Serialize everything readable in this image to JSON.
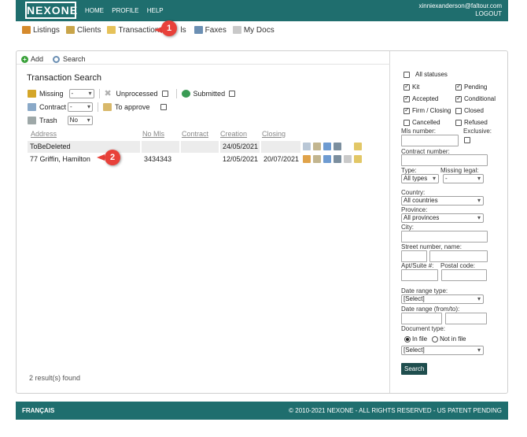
{
  "header": {
    "logo": "NEXONE",
    "nav": [
      "HOME",
      "PROFILE",
      "HELP"
    ],
    "user_email": "xinniexanderson@faltour.com",
    "logout": "LOGOUT"
  },
  "subnav": {
    "items": [
      {
        "label": "Listings",
        "icon": "house-icon"
      },
      {
        "label": "Clients",
        "icon": "clients-icon"
      },
      {
        "label": "Transactions",
        "icon": "folder-icon"
      },
      {
        "label": "ls",
        "icon": ""
      },
      {
        "label": "Faxes",
        "icon": "fax-icon"
      },
      {
        "label": "My Docs",
        "icon": "docs-icon"
      }
    ]
  },
  "annotations": {
    "one": "1",
    "two": "2",
    "color": "#e8413a"
  },
  "toolbar": {
    "add": "Add",
    "search": "Search"
  },
  "search": {
    "title": "Transaction Search",
    "missing_label": "Missing",
    "missing_value": "-",
    "unprocessed_label": "Unprocessed",
    "submitted_label": "Submitted",
    "contract_label": "Contract",
    "contract_value": "-",
    "to_approve_label": "To approve",
    "trash_label": "Trash",
    "trash_value": "No"
  },
  "table": {
    "columns": [
      "Address",
      "No Mls",
      "Contract",
      "Creation",
      "Closing"
    ],
    "rows": [
      {
        "address": "ToBeDeleted",
        "no_mls": "",
        "contract": "",
        "creation": "24/05/2021",
        "closing": ""
      },
      {
        "address": "77 Griffin, Hamilton",
        "no_mls": "3434343",
        "contract": "",
        "creation": "12/05/2021",
        "closing": "20/07/2021"
      }
    ],
    "results": "2 result(s) found"
  },
  "filters": {
    "all_statuses": "All statuses",
    "kit": "Kit",
    "pending": "Pending",
    "accepted": "Accepted",
    "conditional": "Conditional",
    "firm_closing": "Firm / Closing",
    "closed": "Closed",
    "cancelled": "Cancelled",
    "refused": "Refused",
    "mls_number": "Mls number:",
    "exclusive": "Exclusive:",
    "contract_number": "Contract number:",
    "type": "Type:",
    "type_value": "All types",
    "missing_legal": "Missing legal:",
    "missing_legal_value": "-",
    "country": "Country:",
    "country_value": "All countries",
    "province": "Province:",
    "province_value": "All provinces",
    "city": "City:",
    "street": "Street number, name:",
    "apt": "Apt/Suite #:",
    "postal": "Postal code:",
    "date_range_type": "Date range type:",
    "date_range_type_value": "[Select]",
    "date_range": "Date range (from/to):",
    "document_type": "Document type:",
    "in_file": "In file",
    "not_in_file": "Not in file",
    "document_type_value": "[Select]",
    "search_button": "Search"
  },
  "footer": {
    "language": "FRANÇAIS",
    "copyright": "© 2010-2021 NEXONE - ALL RIGHTS RESERVED - US PATENT PENDING"
  },
  "colors": {
    "brand": "#1f6e6e",
    "button": "#1f4e4e"
  }
}
